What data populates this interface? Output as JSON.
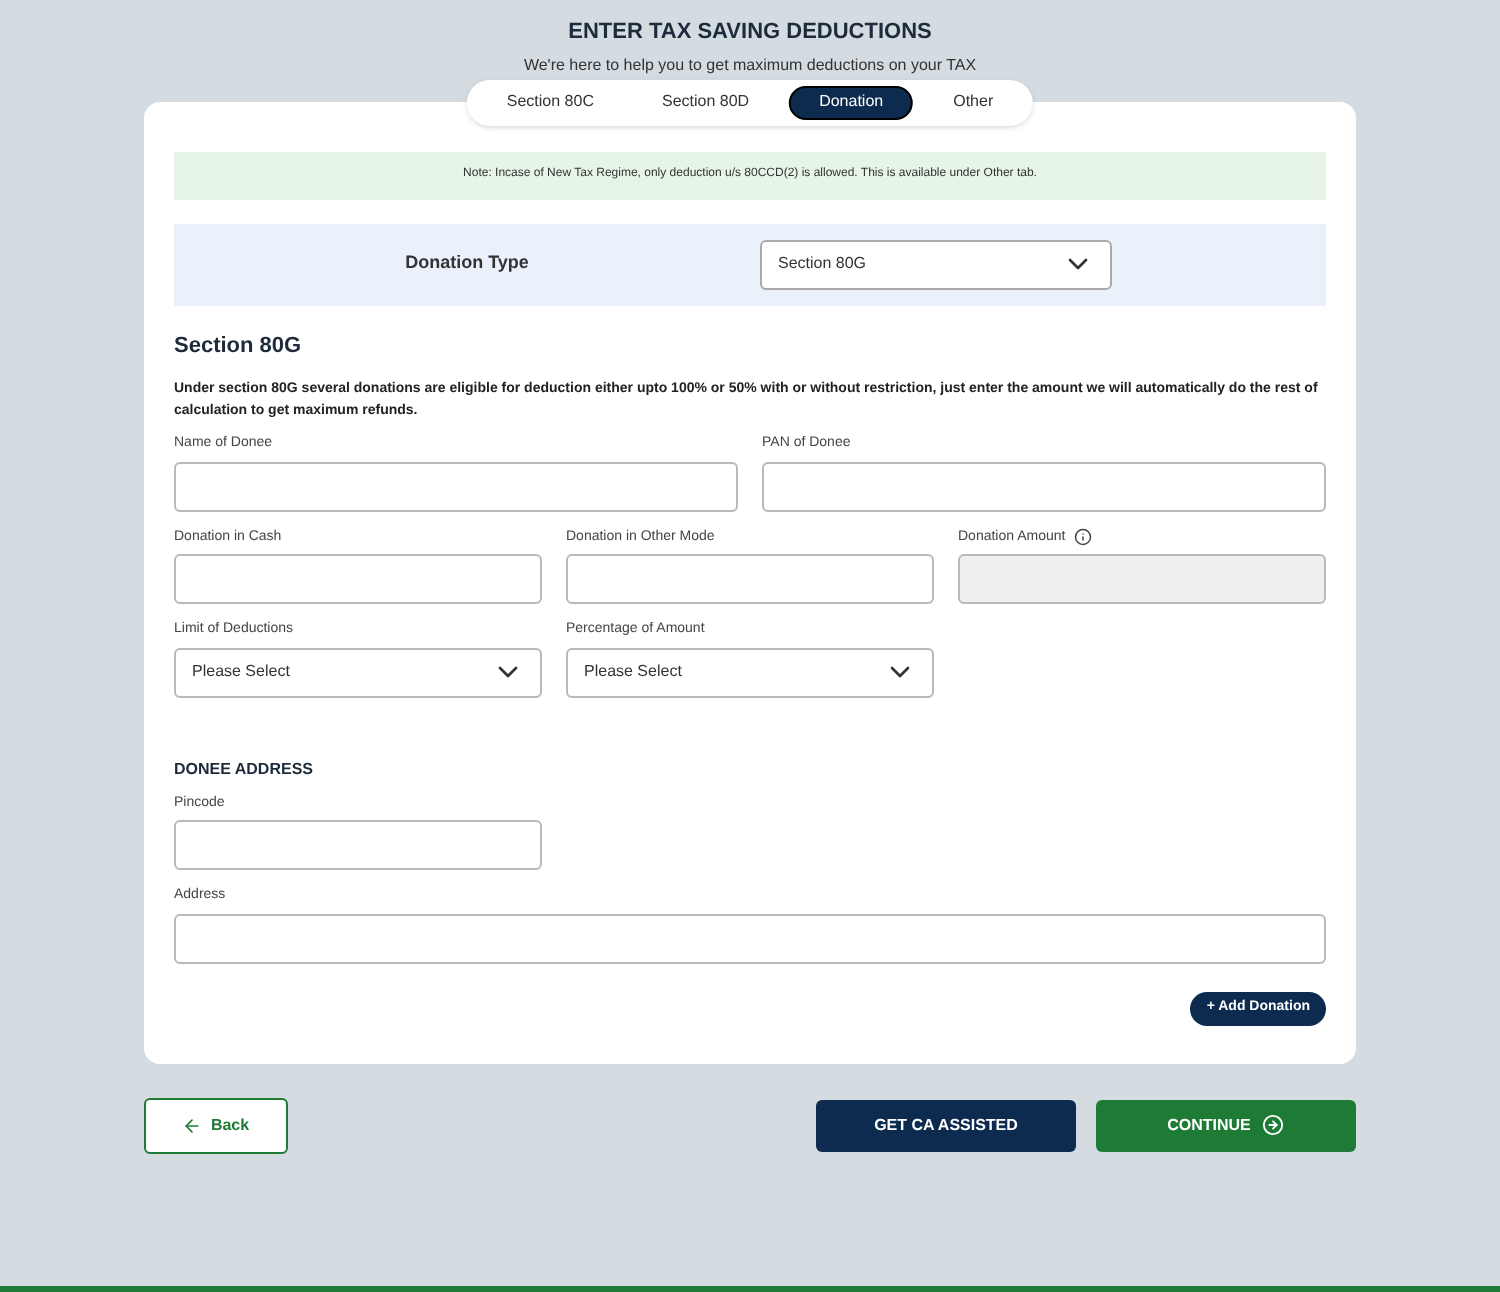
{
  "header": {
    "title": "ENTER TAX SAVING DEDUCTIONS",
    "subtitle": "We're here to help you to get maximum deductions on your TAX"
  },
  "tabs": [
    {
      "label": "Section 80C",
      "selected": false
    },
    {
      "label": "Section 80D",
      "selected": false
    },
    {
      "label": "Donation",
      "selected": true
    },
    {
      "label": "Other",
      "selected": false
    }
  ],
  "note": "Note: Incase of New Tax Regime, only deduction u/s 80CCD(2) is allowed. This is available under Other tab.",
  "donation_type": {
    "label": "Donation Type",
    "value": "Section 80G"
  },
  "section": {
    "title": "Section 80G",
    "description": "Under section 80G several donations are eligible for deduction either upto 100% or 50% with or without restriction, just enter the amount we will automatically do the rest of calculation to get maximum refunds."
  },
  "field_rows": [
    [
      {
        "kind": "text",
        "label": "Name of Donee"
      },
      {
        "kind": "text",
        "label": "PAN of Donee"
      }
    ],
    [
      {
        "kind": "text",
        "label": "Donation in Cash"
      },
      {
        "kind": "text",
        "label": "Donation in Other Mode"
      },
      {
        "kind": "disabled",
        "label": "Donation Amount"
      }
    ],
    [
      {
        "kind": "select",
        "label": "Limit of Deductions",
        "value": "Please Select"
      },
      {
        "kind": "select",
        "label": "Percentage of Amount",
        "value": "Please Select"
      }
    ]
  ],
  "address": {
    "title": "DONEE ADDRESS",
    "fields": [
      {
        "kind": "short",
        "label": "Pincode"
      },
      {
        "kind": "wide",
        "label": "Address"
      }
    ]
  },
  "add_button": "+ Add Donation",
  "footer": {
    "back": "Back",
    "assisted": "GET CA ASSISTED",
    "continue": "CONTINUE"
  }
}
